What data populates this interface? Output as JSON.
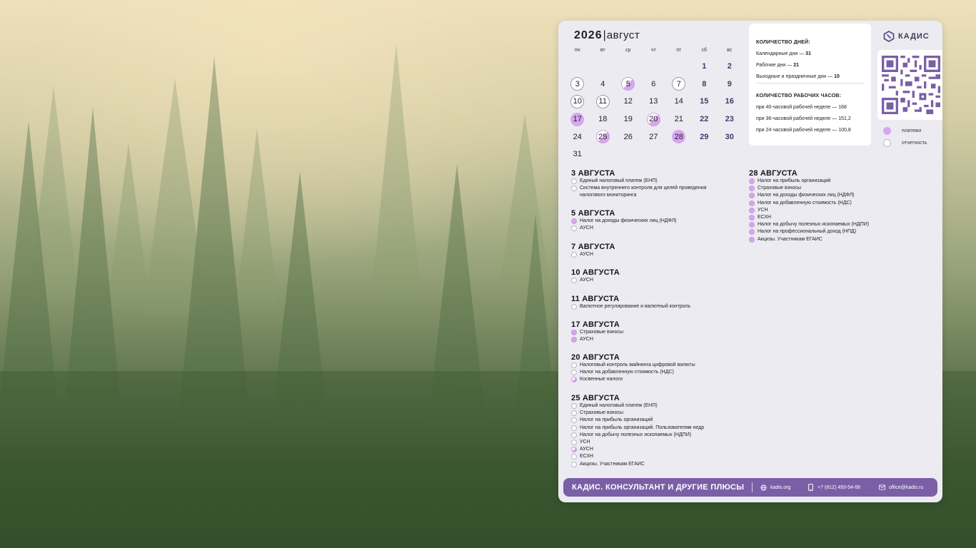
{
  "calendar": {
    "year": "2026",
    "separator": "|",
    "month": "август",
    "weekdays": [
      "пн",
      "вт",
      "ср",
      "чт",
      "пт",
      "сб",
      "вс"
    ],
    "days": [
      {
        "label": "",
        "kind": "empty"
      },
      {
        "label": "",
        "kind": "empty"
      },
      {
        "label": "",
        "kind": "empty"
      },
      {
        "label": "",
        "kind": "empty"
      },
      {
        "label": "",
        "kind": "empty"
      },
      {
        "label": "1",
        "kind": "weekend"
      },
      {
        "label": "2",
        "kind": "weekend"
      },
      {
        "label": "3",
        "kind": "report"
      },
      {
        "label": "4",
        "kind": "plain"
      },
      {
        "label": "5",
        "kind": "mixed"
      },
      {
        "label": "6",
        "kind": "plain"
      },
      {
        "label": "7",
        "kind": "report"
      },
      {
        "label": "8",
        "kind": "weekend"
      },
      {
        "label": "9",
        "kind": "weekend"
      },
      {
        "label": "10",
        "kind": "report"
      },
      {
        "label": "11",
        "kind": "report"
      },
      {
        "label": "12",
        "kind": "plain"
      },
      {
        "label": "13",
        "kind": "plain"
      },
      {
        "label": "14",
        "kind": "plain"
      },
      {
        "label": "15",
        "kind": "weekend"
      },
      {
        "label": "16",
        "kind": "weekend"
      },
      {
        "label": "17",
        "kind": "pay"
      },
      {
        "label": "18",
        "kind": "plain"
      },
      {
        "label": "19",
        "kind": "plain"
      },
      {
        "label": "20",
        "kind": "mixed"
      },
      {
        "label": "21",
        "kind": "plain"
      },
      {
        "label": "22",
        "kind": "weekend"
      },
      {
        "label": "23",
        "kind": "weekend"
      },
      {
        "label": "24",
        "kind": "plain"
      },
      {
        "label": "25",
        "kind": "mixed"
      },
      {
        "label": "26",
        "kind": "plain"
      },
      {
        "label": "27",
        "kind": "plain"
      },
      {
        "label": "28",
        "kind": "pay"
      },
      {
        "label": "29",
        "kind": "weekend"
      },
      {
        "label": "30",
        "kind": "weekend"
      },
      {
        "label": "31",
        "kind": "plain"
      }
    ]
  },
  "stats": {
    "days_heading": "КОЛИЧЕСТВО ДНЕЙ:",
    "calendar_days_label": "Календарные дни — ",
    "calendar_days_value": "31",
    "working_days_label": "Рабочие дни — ",
    "working_days_value": "21",
    "holidays_label": "Выходные и праздничные дни — ",
    "holidays_value": "10",
    "hours_heading": "КОЛИЧЕСТВО РАБОЧИХ ЧАСОВ:",
    "hours_40": "при 40-часовой рабочей неделе — 168",
    "hours_36": "при 36-часовой рабочей неделе — 151,2",
    "hours_24": "при 24-часовой рабочей неделе — 100,8"
  },
  "brand": {
    "logo_text": "КАДИС",
    "logo_icon": "kadis-logo-icon",
    "qr_icon": "qr-code"
  },
  "legend": {
    "payments": "платежи",
    "reports": "отчетность"
  },
  "colors": {
    "payment": "#d8a6f0",
    "report": "#ffffff",
    "footer": "#7a5fa6",
    "panel": "#ecebf1"
  },
  "events": [
    {
      "title": "3 АВГУСТА",
      "items": [
        {
          "text": "Единый налоговый платеж (ЕНП)",
          "kind": "report"
        },
        {
          "text": "Система внутреннего контроля для целей проведения налогового мониторинга",
          "kind": "report"
        }
      ]
    },
    {
      "title": "5 АВГУСТА",
      "items": [
        {
          "text": "Налог на доходы физических лиц (НДФЛ)",
          "kind": "pay"
        },
        {
          "text": "АУСН",
          "kind": "report"
        }
      ]
    },
    {
      "title": "7 АВГУСТА",
      "items": [
        {
          "text": "АУСН",
          "kind": "report"
        }
      ]
    },
    {
      "title": "10 АВГУСТА",
      "items": [
        {
          "text": "АУСН",
          "kind": "report"
        }
      ]
    },
    {
      "title": "11 АВГУСТА",
      "items": [
        {
          "text": "Валютное регулирование и валютный контроль",
          "kind": "report"
        }
      ]
    },
    {
      "title": "17 АВГУСТА",
      "items": [
        {
          "text": "Страховые взносы",
          "kind": "pay"
        },
        {
          "text": "АУСН",
          "kind": "pay"
        }
      ]
    },
    {
      "title": "20 АВГУСТА",
      "items": [
        {
          "text": "Налоговый контроль майнинга цифровой валюты",
          "kind": "report"
        },
        {
          "text": "Налог на добавленную стоимость (НДС)",
          "kind": "report"
        },
        {
          "text": "Косвенные налоги",
          "kind": "mixed"
        }
      ]
    },
    {
      "title": "25 АВГУСТА",
      "items": [
        {
          "text": "Единый налоговый платеж (ЕНП)",
          "kind": "report"
        },
        {
          "text": "Страховые взносы",
          "kind": "report"
        },
        {
          "text": "Налог на прибыль организаций",
          "kind": "report"
        },
        {
          "text": "Налог на прибыль организаций. Пользователям недр",
          "kind": "report"
        },
        {
          "text": "Налог на добычу полезных ископаемых (НДПИ)",
          "kind": "report"
        },
        {
          "text": "УСН",
          "kind": "report"
        },
        {
          "text": "АУСН",
          "kind": "mixed"
        },
        {
          "text": "ЕСХН",
          "kind": "report"
        },
        {
          "text": "Акцизы. Участникам ЕГАИС",
          "kind": "report"
        }
      ]
    },
    {
      "title": "28 АВГУСТА",
      "items": [
        {
          "text": "Налог на прибыль организаций",
          "kind": "pay"
        },
        {
          "text": "Страховые взносы",
          "kind": "pay"
        },
        {
          "text": "Налог на доходы физических лиц (НДФЛ)",
          "kind": "pay"
        },
        {
          "text": "Налог на добавленную стоимость (НДС)",
          "kind": "pay"
        },
        {
          "text": "УСН",
          "kind": "pay"
        },
        {
          "text": "ЕСХН",
          "kind": "pay"
        },
        {
          "text": "Налог на добычу полезных ископаемых (НДПИ)",
          "kind": "pay"
        },
        {
          "text": "Налог на профессиональный доход (НПД)",
          "kind": "pay"
        },
        {
          "text": "Акцизы. Участникам ЕГАИС",
          "kind": "pay"
        }
      ]
    }
  ],
  "footer": {
    "brand": "КАДИС. КОНСУЛЬТАНТ И ДРУГИЕ ПЛЮСЫ",
    "site": "kadis.org",
    "phone": "+7 (812) 493-54-66",
    "email": "office@kadis.ru",
    "site_icon": "globe-icon",
    "phone_icon": "phone-icon",
    "email_icon": "mail-icon"
  },
  "wallpaper": {
    "scene": "misty pine forest"
  }
}
